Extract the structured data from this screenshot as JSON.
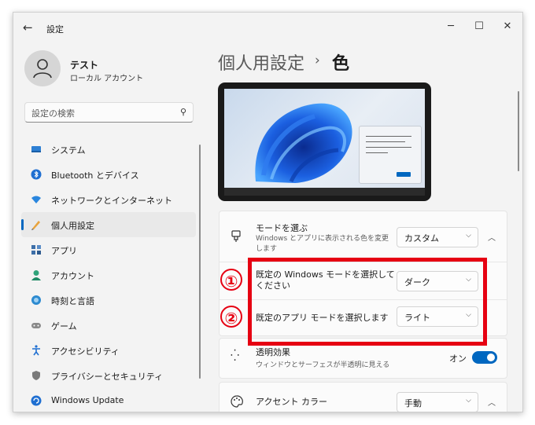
{
  "window": {
    "title": "設定",
    "back_icon": "back-arrow-icon"
  },
  "user": {
    "name": "テスト",
    "account_type": "ローカル アカウント"
  },
  "search": {
    "placeholder": "設定の検索"
  },
  "sidebar": {
    "items": [
      {
        "label": "システム",
        "icon": "system-icon"
      },
      {
        "label": "Bluetooth とデバイス",
        "icon": "bluetooth-icon"
      },
      {
        "label": "ネットワークとインターネット",
        "icon": "network-icon"
      },
      {
        "label": "個人用設定",
        "icon": "personalization-icon",
        "selected": true
      },
      {
        "label": "アプリ",
        "icon": "apps-icon"
      },
      {
        "label": "アカウント",
        "icon": "account-icon"
      },
      {
        "label": "時刻と言語",
        "icon": "time-language-icon"
      },
      {
        "label": "ゲーム",
        "icon": "gaming-icon"
      },
      {
        "label": "アクセシビリティ",
        "icon": "accessibility-icon"
      },
      {
        "label": "プライバシーとセキュリティ",
        "icon": "privacy-icon"
      },
      {
        "label": "Windows Update",
        "icon": "windows-update-icon"
      }
    ]
  },
  "breadcrumb": {
    "parent": "個人用設定",
    "separator": "›",
    "current": "色"
  },
  "mode": {
    "title": "モードを選ぶ",
    "description": "Windows とアプリに表示される色を変更します",
    "value": "カスタム"
  },
  "windows_mode": {
    "label": "既定の Windows モードを選択してください",
    "value": "ダーク"
  },
  "app_mode": {
    "label": "既定のアプリ モードを選択します",
    "value": "ライト"
  },
  "transparency": {
    "title": "透明効果",
    "description": "ウィンドウとサーフェスが半透明に見える",
    "state_label": "オン",
    "enabled": true
  },
  "accent": {
    "title": "アクセント カラー",
    "value": "手動"
  },
  "annotations": {
    "marker1": "①",
    "marker2": "②"
  },
  "colors": {
    "accent": "#0067c0",
    "annotation_red": "#e60012"
  }
}
